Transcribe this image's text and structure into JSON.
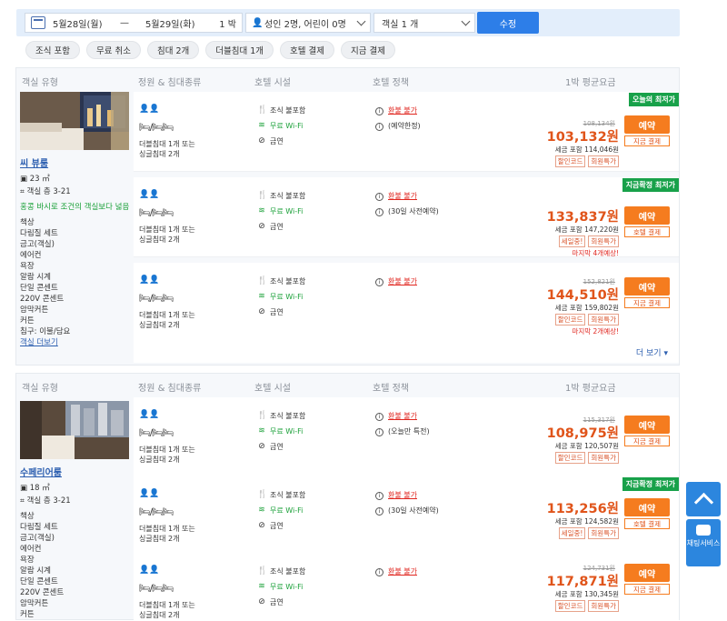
{
  "search": {
    "checkin": "5월28일(월)",
    "dash": "—",
    "checkout": "5월29일(화)",
    "nights": "1 박",
    "guests": "성인 2명, 어린이 0명",
    "rooms": "객실 1 개",
    "button": "수정"
  },
  "filters": [
    "조식 포함",
    "무료 취소",
    "침대 2개",
    "더블침대 1개",
    "호텔 결제",
    "지금 결제"
  ],
  "headers": {
    "room_type": "객실 유형",
    "capacity": "정원 & 침대종류",
    "facilities": "호텔 시설",
    "policy": "호텔 정책",
    "price": "1박 평균요금"
  },
  "rooms": [
    {
      "name": "씨 뷰룸",
      "size": "23 ㎡",
      "floor": "객실 층 3-21",
      "promo": "홍콩 바시로 조건의 객실보다 넓음",
      "amenities": [
        "책상",
        "다림질 세트",
        "금고(객실)",
        "에어컨",
        "욕장",
        "알람 시계",
        "단일 콘센트",
        "220V 콘센트",
        "암막커튼",
        "커튼",
        "침구: 이불/담요"
      ],
      "more_link": "객실 더보기",
      "rates": [
        {
          "badge": "오늘의 최저가",
          "orig": "108,134원",
          "price": "103,132원",
          "tax": "세금 포함 114,046원",
          "tags": [
            "할인코드",
            "회원특가"
          ],
          "note": "",
          "book": "예약",
          "pay": "지금 결제",
          "policy": [
            "환불 불가",
            "(예약한정)"
          ]
        },
        {
          "badge": "지금확정 최저가",
          "orig": "",
          "price": "133,837원",
          "tax": "세금 포함 147,220원",
          "tags": [
            "세일중!",
            "회원특가"
          ],
          "note": "마지막 4개예상!",
          "book": "예약",
          "pay": "호텔 결제",
          "policy": [
            "환불 불가",
            "(30일 사전예약)"
          ]
        },
        {
          "badge": "",
          "orig": "152,821원",
          "price": "144,510원",
          "tax": "세금 포함 159,802원",
          "tags": [
            "할인코드",
            "회원특가"
          ],
          "note": "마지막 2개예상!",
          "book": "예약",
          "pay": "지금 결제",
          "policy": [
            "환불 불가"
          ]
        }
      ],
      "more_rates": "더 보기"
    },
    {
      "name": "수페리어룸",
      "size": "18 ㎡",
      "floor": "객실 층 3-21",
      "promo": "",
      "amenities": [
        "책상",
        "다림질 세트",
        "금고(객실)",
        "에어컨",
        "욕장",
        "알람 시계",
        "단일 콘센트",
        "220V 콘센트",
        "암막커튼",
        "커튼"
      ],
      "more_link": "",
      "rates": [
        {
          "badge": "",
          "orig": "115,317원",
          "price": "108,975원",
          "tax": "세금 포함 120,507원",
          "tags": [
            "할인코드",
            "회원특가"
          ],
          "note": "",
          "book": "예약",
          "pay": "지금 결제",
          "policy": [
            "환불 불가",
            "(오늘만 특전)"
          ]
        },
        {
          "badge": "지금확정 최저가",
          "orig": "",
          "price": "113,256원",
          "tax": "세금 포함 124,582원",
          "tags": [
            "세일중!",
            "회원특가"
          ],
          "note": "",
          "book": "예약",
          "pay": "호텔 결제",
          "policy": [
            "환불 불가",
            "(30일 사전예약)"
          ]
        },
        {
          "badge": "",
          "orig": "124,731원",
          "price": "117,871원",
          "tax": "세금 포함 130,345원",
          "tags": [
            "할인코드",
            "회원특가"
          ],
          "note": "",
          "book": "예약",
          "pay": "지금 결제",
          "policy": [
            "환불 불가"
          ]
        }
      ]
    }
  ],
  "common": {
    "bed_icons": "🛏/🛏🛏",
    "bed_desc1": "더블침대 1개 또는",
    "bed_desc2": "싱글침대 2개",
    "breakfast": "조식 불포함",
    "wifi": "무료 Wi-Fi",
    "nosmoke": "금연"
  },
  "chat": "채팅서비스",
  "colors": {
    "accent": "#2d7ee8",
    "price": "#e0541a",
    "book": "#f57c1f",
    "badge": "#18a14a"
  }
}
